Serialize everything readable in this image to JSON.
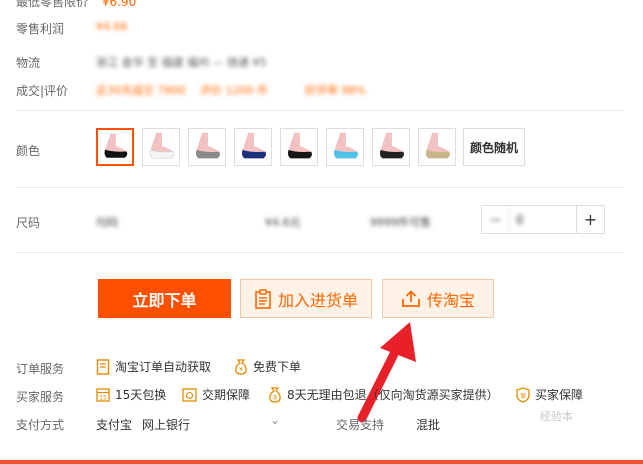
{
  "info": {
    "cut_label": "最低零售限价",
    "cut_value": "¥6.90",
    "profit_label": "零售利润",
    "profit_value": "¥4.66",
    "logistics_label": "物流",
    "logistics_value": "浙江 金华 至 福建 福州 — 快递 ¥5",
    "deal_label": "成交|评价",
    "deal_value_1": "近30天成交 7800",
    "deal_value_2": "评价 1200 件",
    "deal_value_3": "好评率 98%"
  },
  "color": {
    "label": "颜色",
    "swatches": [
      "black",
      "white",
      "gray",
      "navy",
      "black-2",
      "sky-blue",
      "black-3",
      "khaki"
    ],
    "random_label": "颜色随机"
  },
  "size": {
    "label": "尺码",
    "col1": "均码",
    "col2": "¥4.6元",
    "col3": "9999件可售",
    "qty": "0"
  },
  "actions": {
    "buy_label": "立即下单",
    "cart_label": "加入进货单",
    "share_label": "传淘宝"
  },
  "order_service": {
    "label": "订单服务",
    "item1": "淘宝订单自动获取",
    "item2": "免费下单"
  },
  "buyer_service": {
    "label": "买家服务",
    "item1": "15天包换",
    "item2": "交期保障",
    "item3": "8天无理由包退（仅向淘货源买家提供）",
    "item4": "买家保障"
  },
  "payment": {
    "label": "支付方式",
    "method1": "支付宝",
    "method2": "网上银行",
    "trade_label": "交易支持",
    "trade_value": "混批"
  },
  "watermark": "经验本",
  "colors": {
    "accent": "#ff5000",
    "accent_light": "#fff3e8",
    "arrow": "#e8202a"
  }
}
